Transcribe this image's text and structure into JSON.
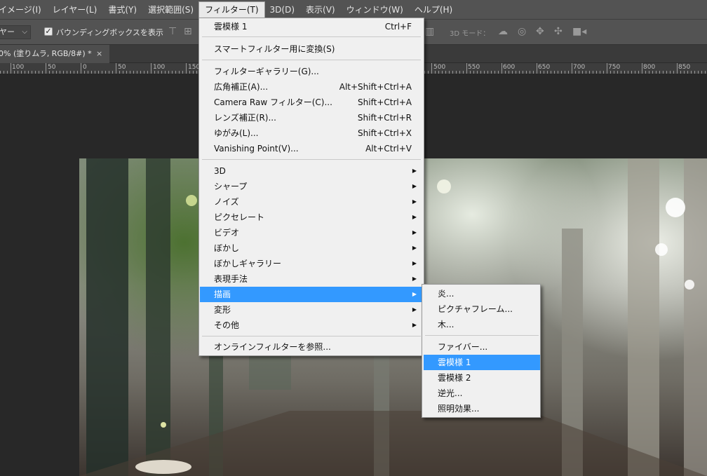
{
  "menubar": {
    "items": [
      "イメージ(I)",
      "レイヤー(L)",
      "書式(Y)",
      "選択範囲(S)",
      "フィルター(T)",
      "3D(D)",
      "表示(V)",
      "ウィンドウ(W)",
      "ヘルプ(H)"
    ],
    "active_index": 4
  },
  "options": {
    "layer_select_value": "ヤー",
    "bounding_box_label": "バウンディングボックスを表示",
    "bounding_box_checked": true,
    "mode_3d_label": "3D モード："
  },
  "document_tab": {
    "label": "0% (塗りムラ, RGB/8#) *",
    "close": "×"
  },
  "ruler": {
    "labels": [
      "100",
      "50",
      "0",
      "50",
      "100",
      "150",
      "500",
      "550",
      "600",
      "650",
      "700",
      "750",
      "800",
      "850"
    ]
  },
  "filter_menu": {
    "last_filter": {
      "label": "雲模様 1",
      "shortcut": "Ctrl+F"
    },
    "smart_filter": "スマートフィルター用に変換(S)",
    "group2": [
      {
        "label": "フィルターギャラリー(G)...",
        "shortcut": ""
      },
      {
        "label": "広角補正(A)...",
        "shortcut": "Alt+Shift+Ctrl+A"
      },
      {
        "label": "Camera Raw フィルター(C)...",
        "shortcut": "Shift+Ctrl+A"
      },
      {
        "label": "レンズ補正(R)...",
        "shortcut": "Shift+Ctrl+R"
      },
      {
        "label": "ゆがみ(L)...",
        "shortcut": "Shift+Ctrl+X"
      },
      {
        "label": "Vanishing Point(V)...",
        "shortcut": "Alt+Ctrl+V"
      }
    ],
    "submenus": [
      "3D",
      "シャープ",
      "ノイズ",
      "ピクセレート",
      "ビデオ",
      "ぼかし",
      "ぼかしギャラリー",
      "表現手法",
      "描画",
      "変形",
      "その他"
    ],
    "highlighted_submenu": "描画",
    "online": "オンラインフィルターを参照..."
  },
  "render_submenu": {
    "group1": [
      "炎...",
      "ピクチャフレーム...",
      "木..."
    ],
    "group2": [
      "ファイバー...",
      "雲模様 1",
      "雲模様 2",
      "逆光...",
      "照明効果..."
    ],
    "highlighted": "雲模様 1"
  },
  "colors": {
    "menu_highlight": "#3399ff",
    "menubar_bg": "#535353",
    "menu_bg": "#f0f0f0"
  }
}
